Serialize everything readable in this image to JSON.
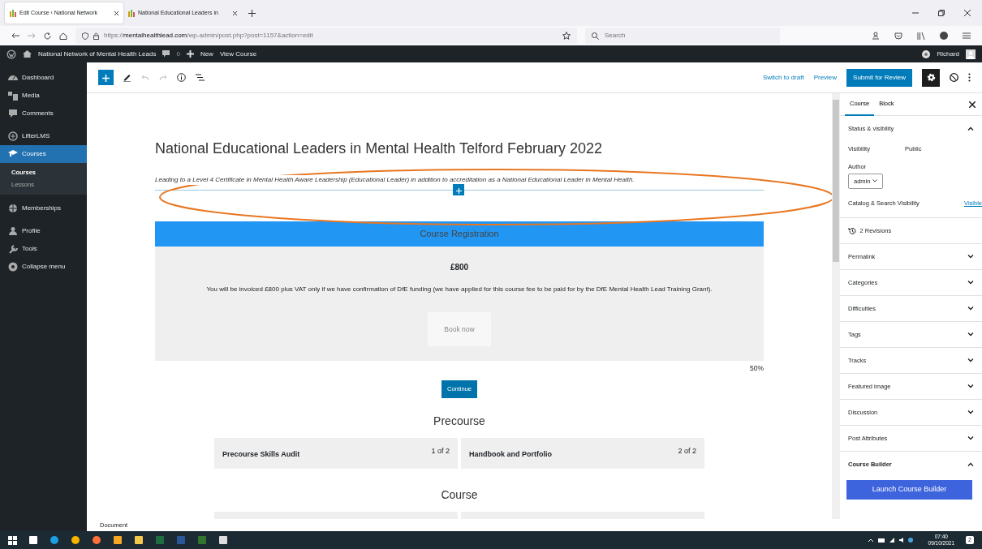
{
  "browser": {
    "tabs": [
      {
        "title": "Edit Course ‹ National Network",
        "selected": true
      },
      {
        "title": "National Educational Leaders in",
        "selected": false
      }
    ],
    "url": "https://**mentalhealthlead.com**/wp-admin/post.php?post=1157&action=edit",
    "search": {
      "placeholder": "Search"
    }
  },
  "admin_bar": {
    "site": "National Network of Mental Health Leads",
    "comments": "0",
    "new": "New",
    "view": "View Course",
    "user": "Richard"
  },
  "sidebar": {
    "items": [
      {
        "label": "Dashboard",
        "selected": false
      },
      {
        "label": "Media",
        "selected": false
      },
      {
        "label": "Comments",
        "selected": false
      },
      {
        "label": "LifterLMS",
        "selected": false
      },
      {
        "label": "Courses",
        "selected": true,
        "children": [
          {
            "label": "Courses",
            "selected": true
          },
          {
            "label": "Lessons",
            "selected": false
          }
        ]
      },
      {
        "label": "Memberships",
        "selected": false
      },
      {
        "label": "Profile",
        "selected": false
      },
      {
        "label": "Tools",
        "selected": false
      },
      {
        "label": "Collapse menu",
        "selected": false
      }
    ]
  },
  "toolbar": {
    "actions": [
      "Switch to draft",
      "Preview"
    ],
    "primary": "Submit for Review"
  },
  "content": {
    "title": "National Educational Leaders in Mental Health Telford February 2022",
    "subtitle": "Leading to a Level 4 Certificate in Mental Health Aware Leadership (Educational Leader) in addition to accreditation as a National Educational Leader in Mental Health.",
    "annotation": {
      "kind": "ellipse",
      "color": "#e87722"
    },
    "registration": {
      "header": "Course Registration",
      "price": "£800",
      "note": "You will be invoiced £800 plus VAT only if we have confirmation of DfE funding (we have applied for this course fee to be paid for by the DfE Mental Health Lead Training Grant).",
      "button": "Book now"
    },
    "progress": "50%",
    "continue": "Continue",
    "sections": [
      {
        "title": "Precourse",
        "lessons": [
          {
            "kind": "lesson",
            "title": "Precourse Skills Audit",
            "count": "1 of 2"
          },
          {
            "kind": "lesson",
            "title": "Handbook and Portfolio",
            "count": "2 of 2"
          }
        ]
      },
      {
        "title": "Course",
        "lessons": [
          {
            "kind": "cut_off"
          },
          {
            "kind": "cut_off"
          }
        ]
      }
    ]
  },
  "panel": {
    "tabs": [
      {
        "label": "Course",
        "selected": true
      },
      {
        "label": "Block",
        "selected": false
      }
    ],
    "status": {
      "title": "Status & visibility",
      "expanded": true,
      "visibility_label": "Visibility",
      "visibility": "Public",
      "author_label": "Author",
      "author": "admin",
      "catalog_label": "Catalog & Search Visibility",
      "catalog": "Visible"
    },
    "revisions": "2 Revisions",
    "sections": [
      {
        "title": "Permalink",
        "expanded": false
      },
      {
        "title": "Categories",
        "expanded": false
      },
      {
        "title": "Difficulties",
        "expanded": false
      },
      {
        "title": "Tags",
        "expanded": false
      },
      {
        "title": "Tracks",
        "expanded": false
      },
      {
        "title": "Featured image",
        "expanded": false
      },
      {
        "title": "Discussion",
        "expanded": false
      },
      {
        "title": "Post Attributes",
        "expanded": false
      },
      {
        "title": "Course Builder",
        "expanded": true
      }
    ],
    "builder_button": "Launch Course Builder"
  },
  "status_bar": "Document",
  "taskbar": {
    "time": "07:40",
    "date": "09/10/2021",
    "notifications": "2"
  }
}
